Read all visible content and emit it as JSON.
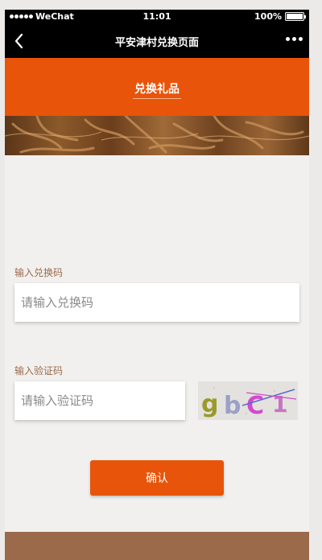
{
  "status_bar": {
    "carrier": "WeChat",
    "time": "11:01",
    "battery_percent": "100%",
    "battery_level": 1.0
  },
  "nav": {
    "title": "平安津村兑换页面",
    "back_icon": "chevron-left-icon",
    "more_icon": "more-dots-icon"
  },
  "header": {
    "title": "兑换礼品"
  },
  "form": {
    "code_label": "输入兑换码",
    "code_placeholder": "请输入兑换码",
    "code_value": "",
    "verify_label": "输入验证码",
    "verify_placeholder": "请输入验证码",
    "verify_value": "",
    "captcha_text": "gbc1"
  },
  "actions": {
    "confirm_label": "确认"
  },
  "colors": {
    "accent": "#e8540a",
    "label": "#9b6b4e",
    "footer": "#9a6a4a",
    "nav_bg": "#000000"
  }
}
